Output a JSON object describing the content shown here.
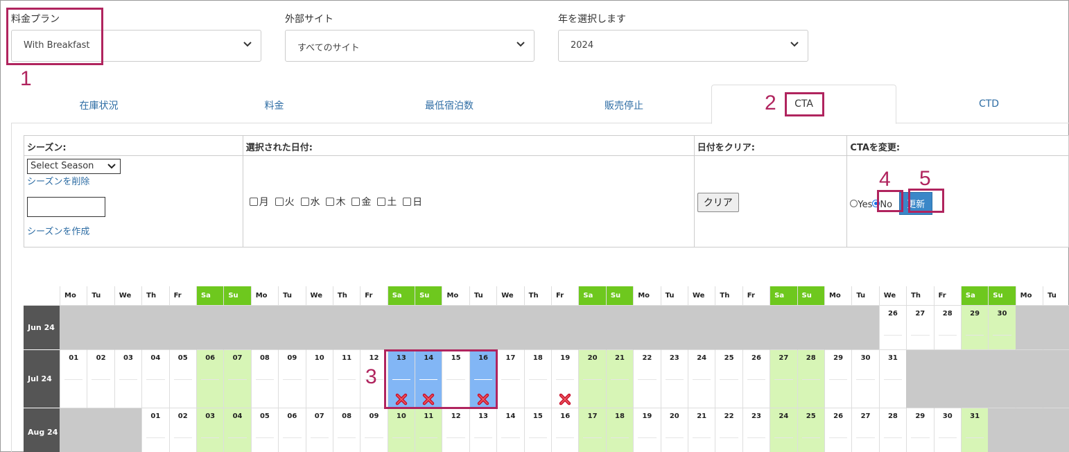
{
  "filters": {
    "plan_label": "料金プラン",
    "plan_value": "With Breakfast",
    "site_label": "外部サイト",
    "site_value": "すべてのサイト",
    "year_label": "年を選択します",
    "year_value": "2024"
  },
  "tabs": [
    "在庫状況",
    "料金",
    "最低宿泊数",
    "販売停止",
    "CTA",
    "CTD"
  ],
  "controls": {
    "season_header": "シーズン:",
    "season_select": "Select Season",
    "delete_season": "シーズンを削除",
    "create_season": "シーズンを作成",
    "dates_header": "選択された日付:",
    "weekdays": [
      "月",
      "火",
      "水",
      "木",
      "金",
      "土",
      "日"
    ],
    "clear_header": "日付をクリア:",
    "clear_button": "クリア",
    "cta_header": "CTAを変更:",
    "yes_label": "Yes",
    "no_label": "No",
    "update_button": "更新"
  },
  "annotations": [
    "1",
    "2",
    "3",
    "4",
    "5"
  ],
  "calendar": {
    "header_days": [
      "Mo",
      "Tu",
      "We",
      "Th",
      "Fr",
      "Sa",
      "Su",
      "Mo",
      "Tu",
      "We",
      "Th",
      "Fr",
      "Sa",
      "Su",
      "Mo",
      "Tu",
      "We",
      "Th",
      "Fr",
      "Sa",
      "Su",
      "Mo",
      "Tu",
      "We",
      "Th",
      "Fr",
      "Sa",
      "Su",
      "Mo",
      "Tu",
      "We",
      "Th",
      "Fr",
      "Sa",
      "Su",
      "Mo",
      "Tu"
    ],
    "months": [
      {
        "label": "Jun 24",
        "offset": 30,
        "days": [
          "26",
          "27",
          "28",
          "29",
          "30"
        ]
      },
      {
        "label": "Jul 24",
        "offset": 0,
        "days": [
          "01",
          "02",
          "03",
          "04",
          "05",
          "06",
          "07",
          "08",
          "09",
          "10",
          "11",
          "12",
          "13",
          "14",
          "15",
          "16",
          "17",
          "18",
          "19",
          "20",
          "21",
          "22",
          "23",
          "24",
          "25",
          "26",
          "27",
          "28",
          "29",
          "30",
          "31"
        ]
      },
      {
        "label": "Aug 24",
        "offset": 3,
        "days": [
          "01",
          "02",
          "03",
          "04",
          "05",
          "06",
          "07",
          "08",
          "09",
          "10",
          "11",
          "12",
          "13",
          "14",
          "15",
          "16",
          "17",
          "18",
          "19",
          "20",
          "21",
          "22",
          "23",
          "24",
          "25",
          "26",
          "27",
          "28",
          "29",
          "30",
          "31"
        ]
      }
    ],
    "selected": {
      "Jul 24": [
        "13",
        "14",
        "15",
        "16"
      ]
    },
    "cta_marked": {
      "Jul 24": [
        "13",
        "14",
        "16",
        "19"
      ]
    }
  },
  "colors": {
    "accent": "#b0245e",
    "weekend": "#6ec81e",
    "weekend_light": "#d7f5b6",
    "selected": "#82b6f5",
    "update": "#3a87c8"
  }
}
